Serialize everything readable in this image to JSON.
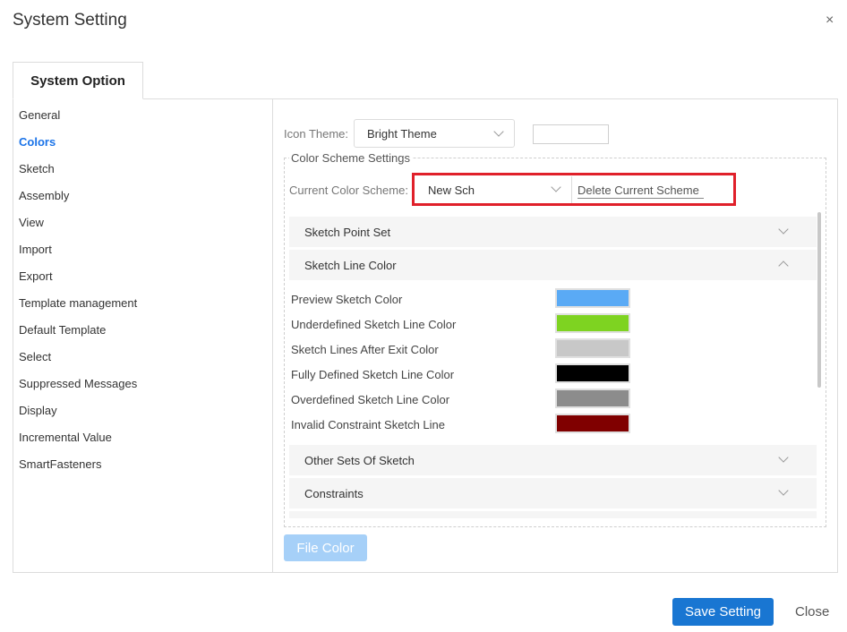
{
  "dialog": {
    "title": "System Setting",
    "close_glyph": "×"
  },
  "tabs": [
    {
      "label": "System Option"
    }
  ],
  "sidebar": {
    "items": [
      {
        "label": "General"
      },
      {
        "label": "Colors",
        "active": true
      },
      {
        "label": "Sketch"
      },
      {
        "label": "Assembly"
      },
      {
        "label": "View"
      },
      {
        "label": "Import"
      },
      {
        "label": "Export"
      },
      {
        "label": "Template management"
      },
      {
        "label": "Default Template"
      },
      {
        "label": "Select"
      },
      {
        "label": "Suppressed Messages"
      },
      {
        "label": "Display"
      },
      {
        "label": "Incremental Value"
      },
      {
        "label": "SmartFasteners"
      }
    ]
  },
  "icon_theme": {
    "label": "Icon Theme:",
    "value": "Bright Theme"
  },
  "color_scheme": {
    "legend": "Color Scheme Settings",
    "current_label": "Current Color Scheme:",
    "current_value": "New Sch",
    "delete_label": "Delete Current Scheme"
  },
  "sections": [
    {
      "label": "Sketch Point Set",
      "expanded": false
    },
    {
      "label": "Sketch Line Color",
      "expanded": true
    },
    {
      "label": "Other Sets Of Sketch",
      "expanded": false
    },
    {
      "label": "Constraints",
      "expanded": false
    }
  ],
  "sketch_line_colors": [
    {
      "label": "Preview Sketch Color",
      "color": "#5aaaf5"
    },
    {
      "label": "Underdefined Sketch Line Color",
      "color": "#7ed321"
    },
    {
      "label": "Sketch Lines After Exit Color",
      "color": "#c8c8c8"
    },
    {
      "label": "Fully Defined Sketch Line Color",
      "color": "#000000"
    },
    {
      "label": "Overdefined Sketch Line Color",
      "color": "#8c8c8c"
    },
    {
      "label": "Invalid Constraint Sketch Line",
      "color": "#800000"
    }
  ],
  "buttons": {
    "file_color": "File Color",
    "save": "Save Setting",
    "close": "Close"
  },
  "colors": {
    "accent": "#1976d2",
    "highlight": "#e0202a"
  }
}
